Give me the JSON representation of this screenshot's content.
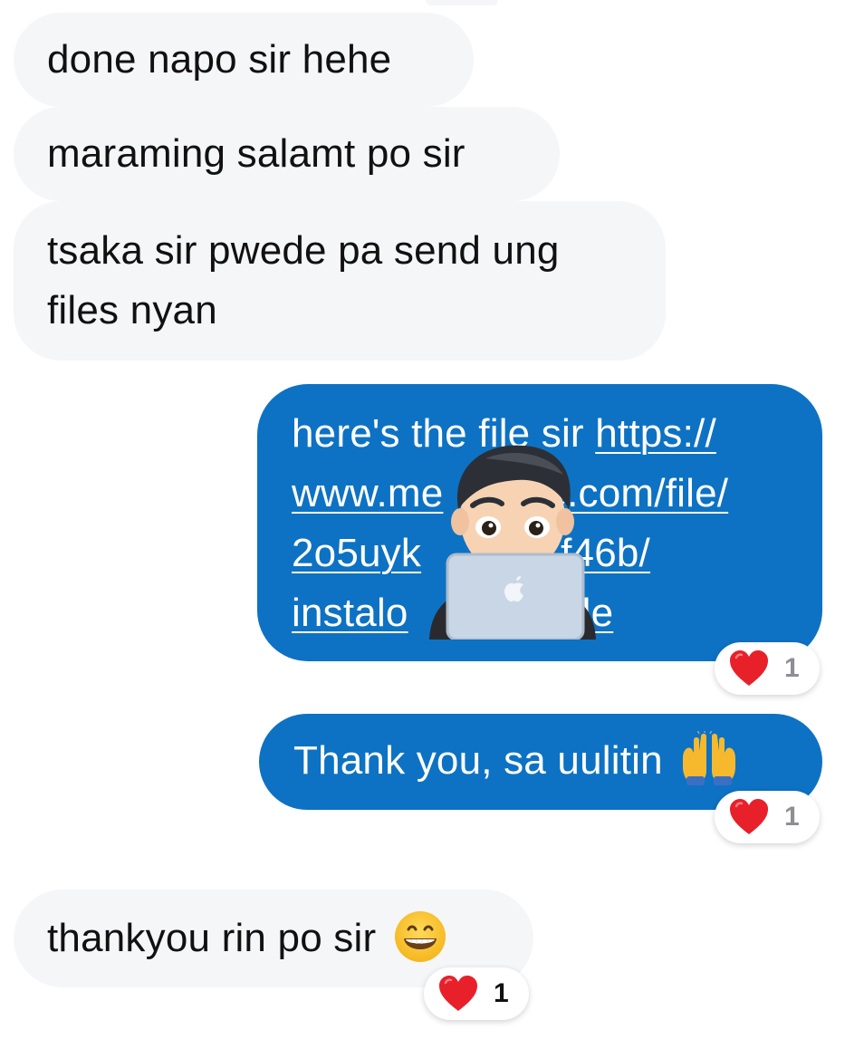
{
  "messages": {
    "incoming_1": {
      "text": "done napo sir hehe"
    },
    "incoming_2": {
      "text": "maraming salamt po sir"
    },
    "incoming_3": {
      "line1": "tsaka sir pwede pa send ung",
      "line2": "files nyan"
    },
    "outgoing_1": {
      "prefix": "here's the file sir ",
      "link_lines": [
        "https://",
        "www.mediafire.com/file/",
        "2o5uyk...f46b/",
        "instalo...file"
      ],
      "visible_lines": [
        {
          "lead": "here's the fi",
          "tail_lead": "le sir ",
          "link": "https://"
        },
        {
          "link_a": "www.me",
          "link_b": "e.com/file/"
        },
        {
          "link_a": "2o5uyk",
          "link_b": "f46b/"
        },
        {
          "link_a": "instalo",
          "link_b": "le"
        }
      ],
      "reaction": {
        "icon": "red-heart-icon",
        "count": "1"
      }
    },
    "outgoing_2": {
      "text": "Thank you, sa uulitin",
      "emoji": "raising-hands-emoji",
      "reaction": {
        "icon": "red-heart-icon",
        "count": "1"
      }
    },
    "incoming_4": {
      "text": "thankyou rin po sir",
      "emoji": "grinning-face-emoji",
      "reaction": {
        "icon": "red-heart-icon",
        "count": "1"
      }
    }
  },
  "overlay": {
    "icon": "memoji-with-laptop-icon"
  },
  "colors": {
    "incoming_bubble": "#f5f6f8",
    "outgoing_bubble": "#0d72c3",
    "incoming_text": "#111111",
    "outgoing_text": "#ffffff",
    "reaction_count_gray": "#8e8e93",
    "reaction_count_dark": "#111111"
  }
}
